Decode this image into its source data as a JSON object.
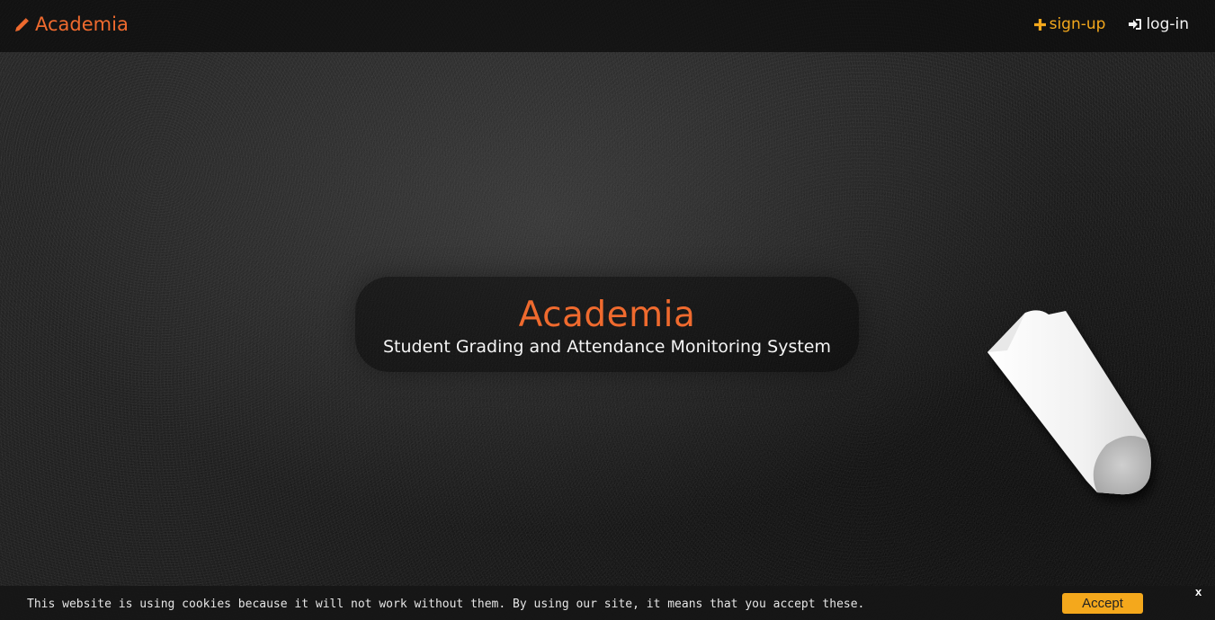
{
  "navbar": {
    "brand": {
      "label": "Academia",
      "icon": "pencil-icon"
    },
    "links": [
      {
        "label": "sign-up",
        "icon": "plus-icon"
      },
      {
        "label": "log-in",
        "icon": "sign-in-icon"
      }
    ]
  },
  "hero": {
    "title": "Academia",
    "subtitle": "Student Grading and Attendance Monitoring System"
  },
  "cookie_banner": {
    "message": "This website is using cookies because it will not work without them. By using our site, it means that you accept these.",
    "accept_label": "Accept",
    "close_label": "x"
  },
  "colors": {
    "brand_orange": "#ef6a2e",
    "accent_yellow": "#f4a81c",
    "background": "#141414"
  }
}
